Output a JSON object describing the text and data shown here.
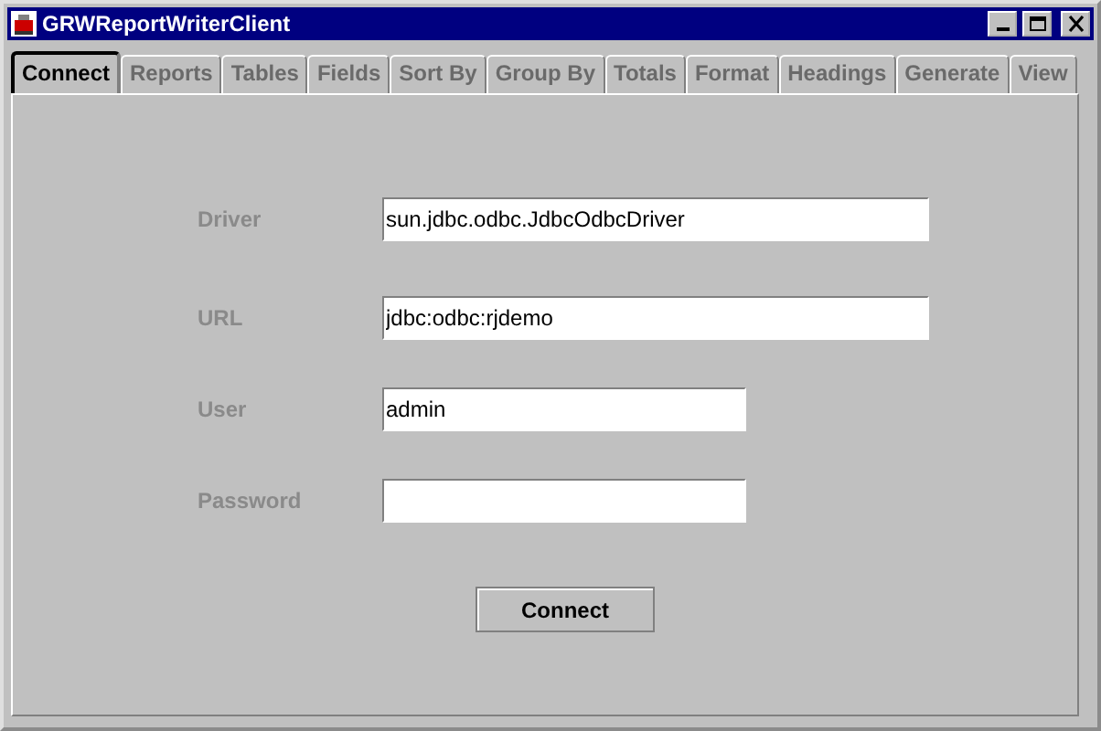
{
  "window": {
    "title": "GRWReportWriterClient"
  },
  "tabs": [
    {
      "label": "Connect",
      "selected": true,
      "disabled": false
    },
    {
      "label": "Reports",
      "selected": false,
      "disabled": true
    },
    {
      "label": "Tables",
      "selected": false,
      "disabled": true
    },
    {
      "label": "Fields",
      "selected": false,
      "disabled": true
    },
    {
      "label": "Sort By",
      "selected": false,
      "disabled": true
    },
    {
      "label": "Group By",
      "selected": false,
      "disabled": true
    },
    {
      "label": "Totals",
      "selected": false,
      "disabled": true
    },
    {
      "label": "Format",
      "selected": false,
      "disabled": true
    },
    {
      "label": "Headings",
      "selected": false,
      "disabled": true
    },
    {
      "label": "Generate",
      "selected": false,
      "disabled": true
    },
    {
      "label": "View",
      "selected": false,
      "disabled": true
    }
  ],
  "fields": [
    {
      "label": "Driver",
      "value": "sun.jdbc.odbc.JdbcOdbcDriver",
      "kind": "text"
    },
    {
      "label": "URL",
      "value": "jdbc:odbc:rjdemo",
      "kind": "text"
    },
    {
      "label": "User",
      "value": "admin",
      "kind": "text"
    },
    {
      "label": "Password",
      "kind": "password"
    }
  ],
  "button": {
    "label": "Connect"
  }
}
